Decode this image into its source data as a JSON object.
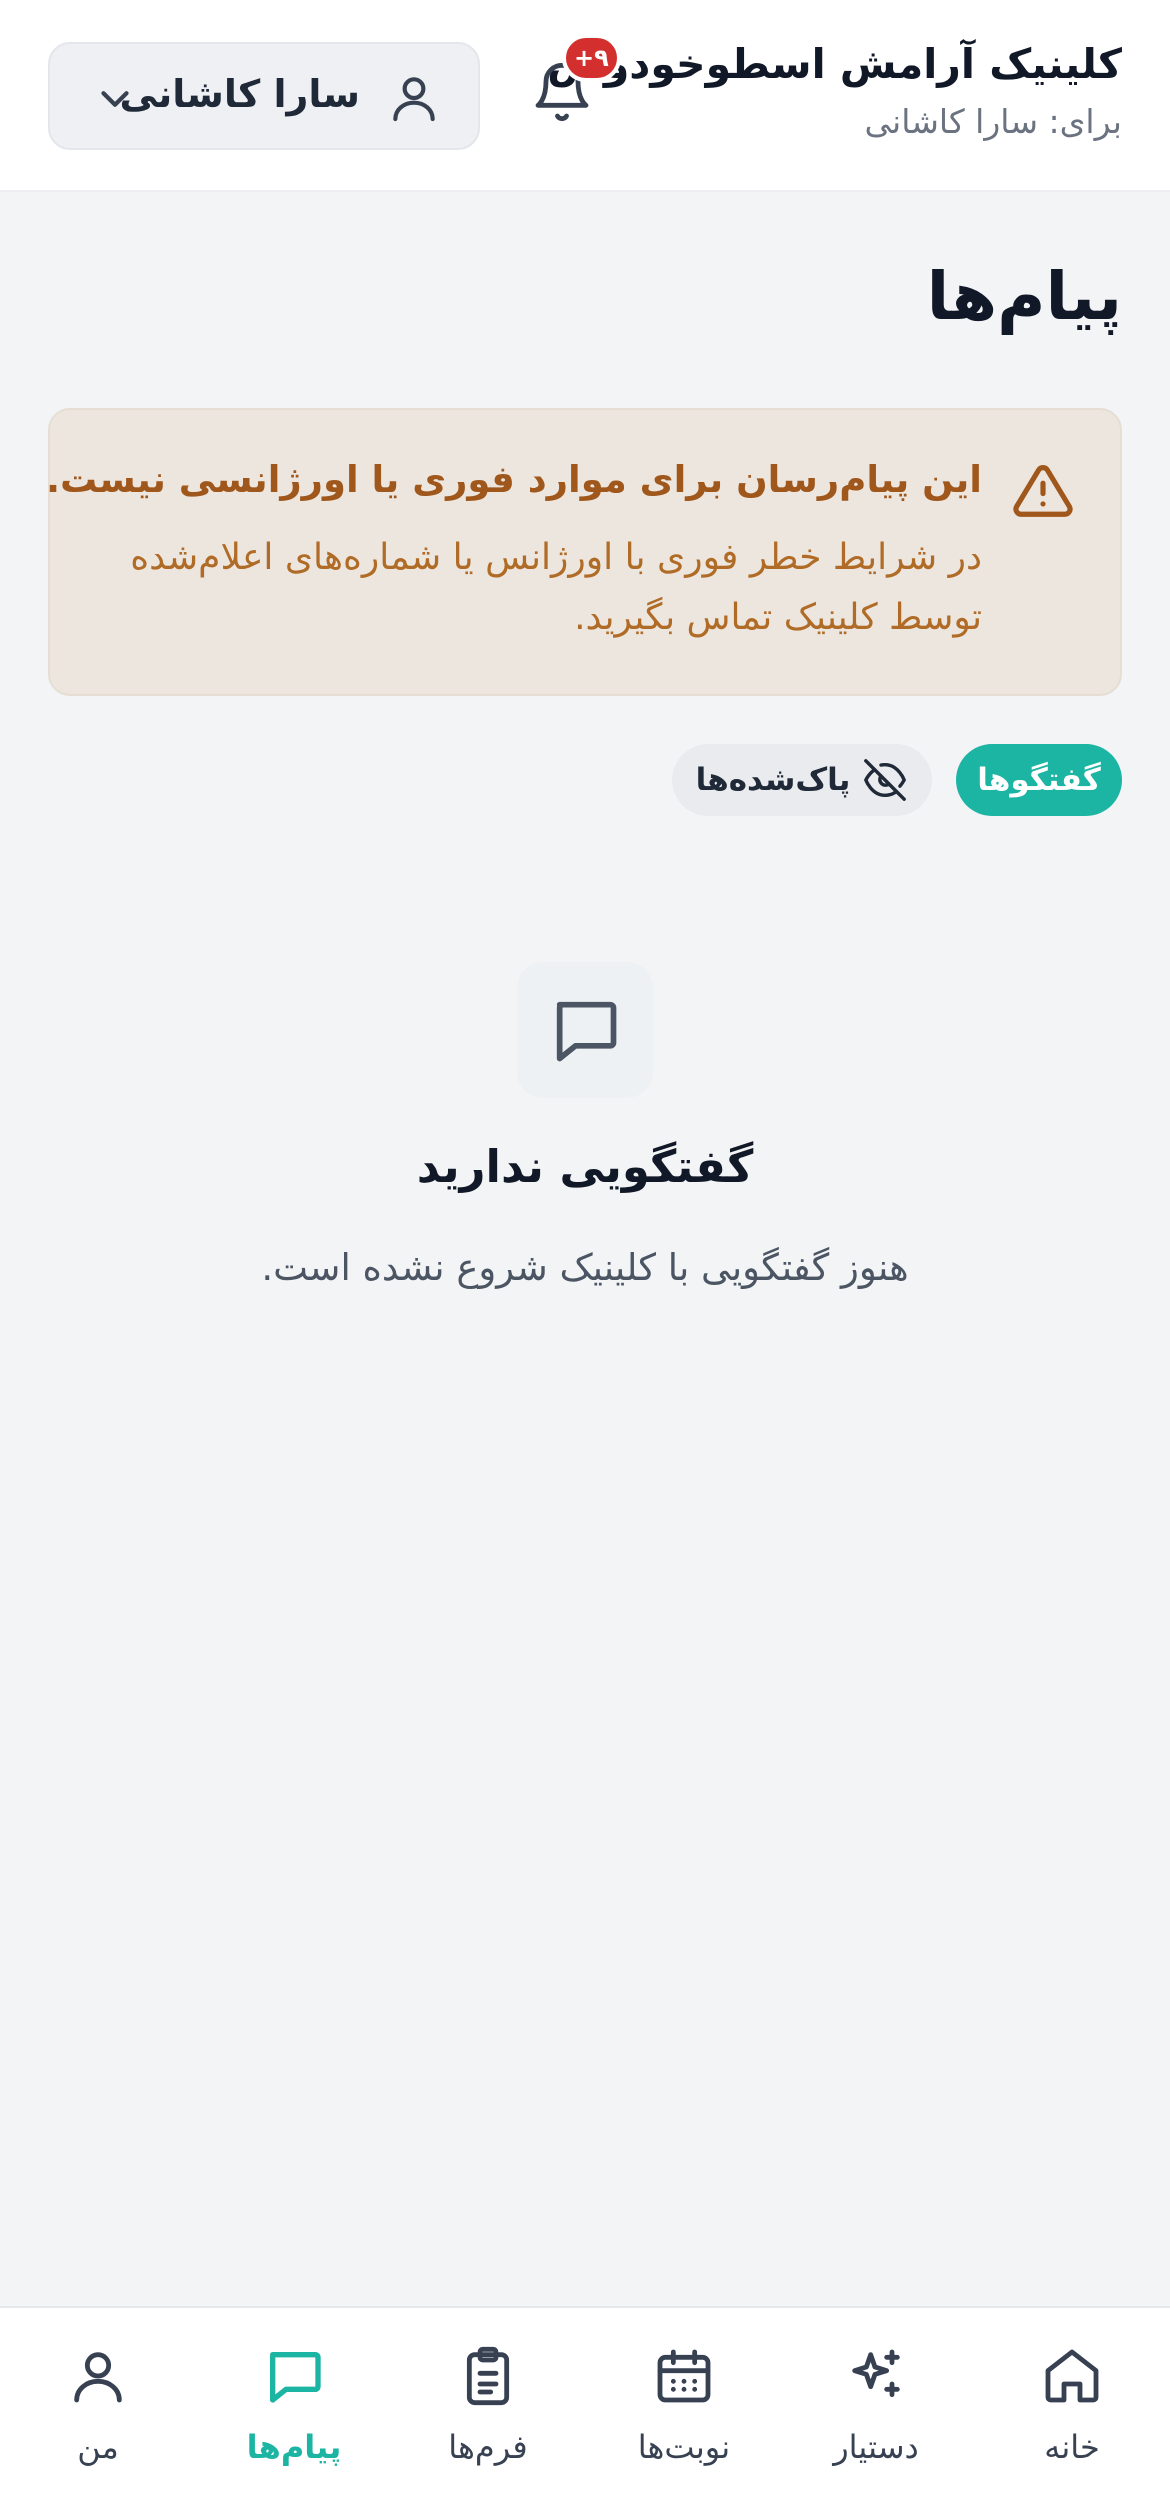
{
  "header": {
    "clinic_name": "کلینیک آرامش اسطوخودوس",
    "for_user": "برای: سارا کاشانی",
    "notification_badge": "۹+",
    "user_picker_name": "سارا کاشانی"
  },
  "page": {
    "title": "پیام‌ها"
  },
  "warning": {
    "title": "این پیام‌رسان برای موارد فوری یا اورژانسی نیست.",
    "body": "در شرایط خطر فوری با اورژانس یا شماره‌های اعلام‌شده توسط کلینیک تماس بگیرید."
  },
  "tabs": {
    "conversations": "گفتگوها",
    "cleared": "پاک‌شده‌ها"
  },
  "empty_state": {
    "title": "گفتگویی ندارید",
    "subtitle": "هنوز گفتگویی با کلینیک شروع نشده است."
  },
  "bottom_nav": {
    "items": [
      {
        "label": "خانه",
        "icon": "home-icon"
      },
      {
        "label": "دستیار",
        "icon": "sparkle-icon"
      },
      {
        "label": "نوبت‌ها",
        "icon": "calendar-icon"
      },
      {
        "label": "فرم‌ها",
        "icon": "clipboard-icon"
      },
      {
        "label": "پیام‌ها",
        "icon": "message-icon",
        "active": true
      },
      {
        "label": "من",
        "icon": "person-icon"
      }
    ]
  },
  "colors": {
    "accent": "#1cb5a3",
    "badge": "#d32f2f",
    "warning_bg": "#ede6df",
    "warning_text": "#a0571b"
  }
}
